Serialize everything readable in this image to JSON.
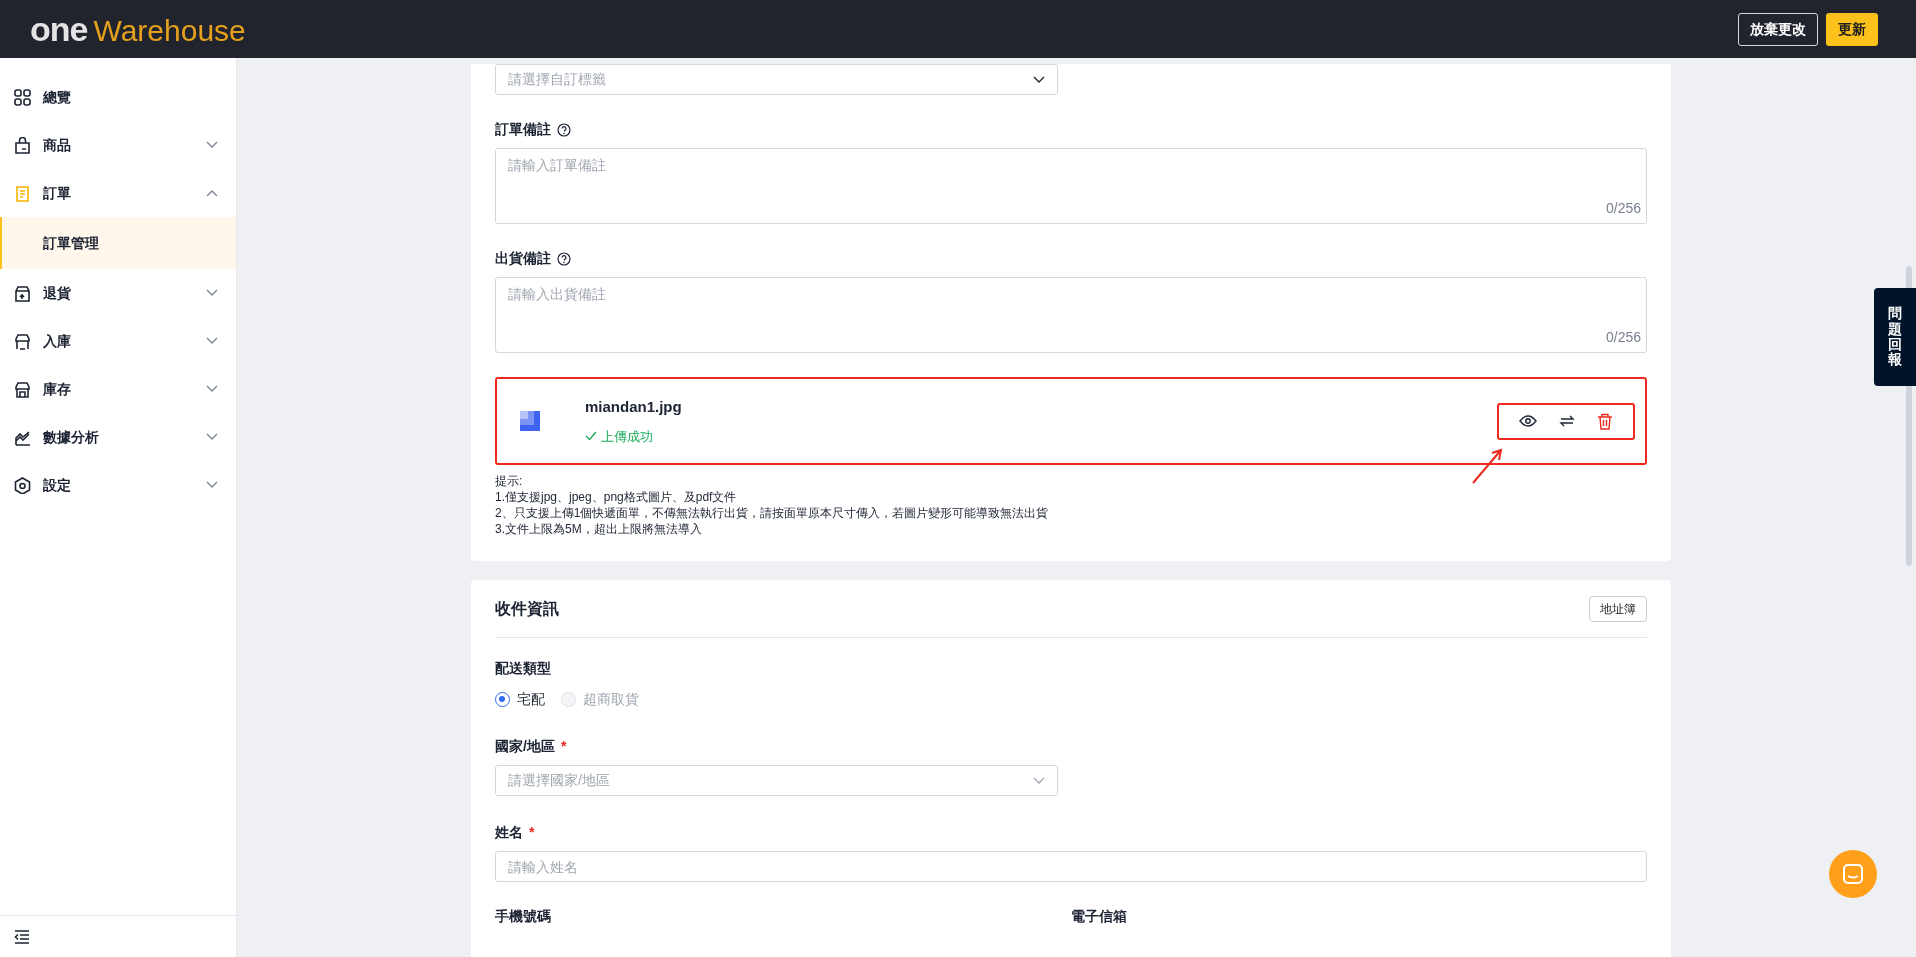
{
  "header": {
    "logo": {
      "part_1": "one",
      "part_2": "Warehouse"
    },
    "buttons": [
      {
        "label": "放棄更改",
        "kind": "outline"
      },
      {
        "label": "更新",
        "kind": "primary"
      }
    ]
  },
  "sidebar": {
    "items": [
      {
        "label": "總覽",
        "selected": false
      },
      {
        "label": "商品",
        "selected": false,
        "expanded": false
      },
      {
        "label": "訂單",
        "selected": true,
        "expanded": true,
        "children": [
          {
            "label": "訂單管理",
            "selected": true
          }
        ]
      },
      {
        "label": "退貨",
        "selected": false,
        "expanded": false
      },
      {
        "label": "入庫",
        "selected": false,
        "expanded": false
      },
      {
        "label": "庫存",
        "selected": false,
        "expanded": false
      },
      {
        "label": "數據分析",
        "selected": false,
        "expanded": false
      },
      {
        "label": "設定",
        "selected": false,
        "expanded": false
      }
    ]
  },
  "order_card": {
    "tag_select": {
      "placeholder": "請選擇自訂標籤"
    },
    "notes": [
      {
        "label": "訂單備註",
        "placeholder": "請輸入訂單備註",
        "counter": "0/256"
      },
      {
        "label": "出貨備註",
        "placeholder": "請輸入出貨備註",
        "counter": "0/256"
      }
    ],
    "upload": {
      "file_name": "miandan1.jpg",
      "status": "上傳成功"
    },
    "hints": [
      "提示:",
      "1.僅支援jpg、jpeg、png格式圖片、及pdf文件",
      "2、只支援上傳1個快遞面單，不傳無法執行出貨，請按面單原本尺寸傳入，若圖片變形可能導致無法出貨",
      "3.文件上限為5M，超出上限將無法導入"
    ]
  },
  "recipient_card": {
    "title": "收件資訊",
    "address_book_button": "地址簿",
    "delivery_type": {
      "label": "配送類型",
      "options": [
        {
          "label": "宅配",
          "selected": true,
          "disabled": false
        },
        {
          "label": "超商取貨",
          "selected": false,
          "disabled": true
        }
      ]
    },
    "country": {
      "label": "國家/地區",
      "required_mark": "*",
      "placeholder": "請選擇國家/地區"
    },
    "name": {
      "label": "姓名",
      "required_mark": "*",
      "placeholder": "請輸入姓名"
    },
    "more_labels": [
      "手機號碼",
      "電子信箱"
    ]
  },
  "feedback_tab": "問題回報"
}
